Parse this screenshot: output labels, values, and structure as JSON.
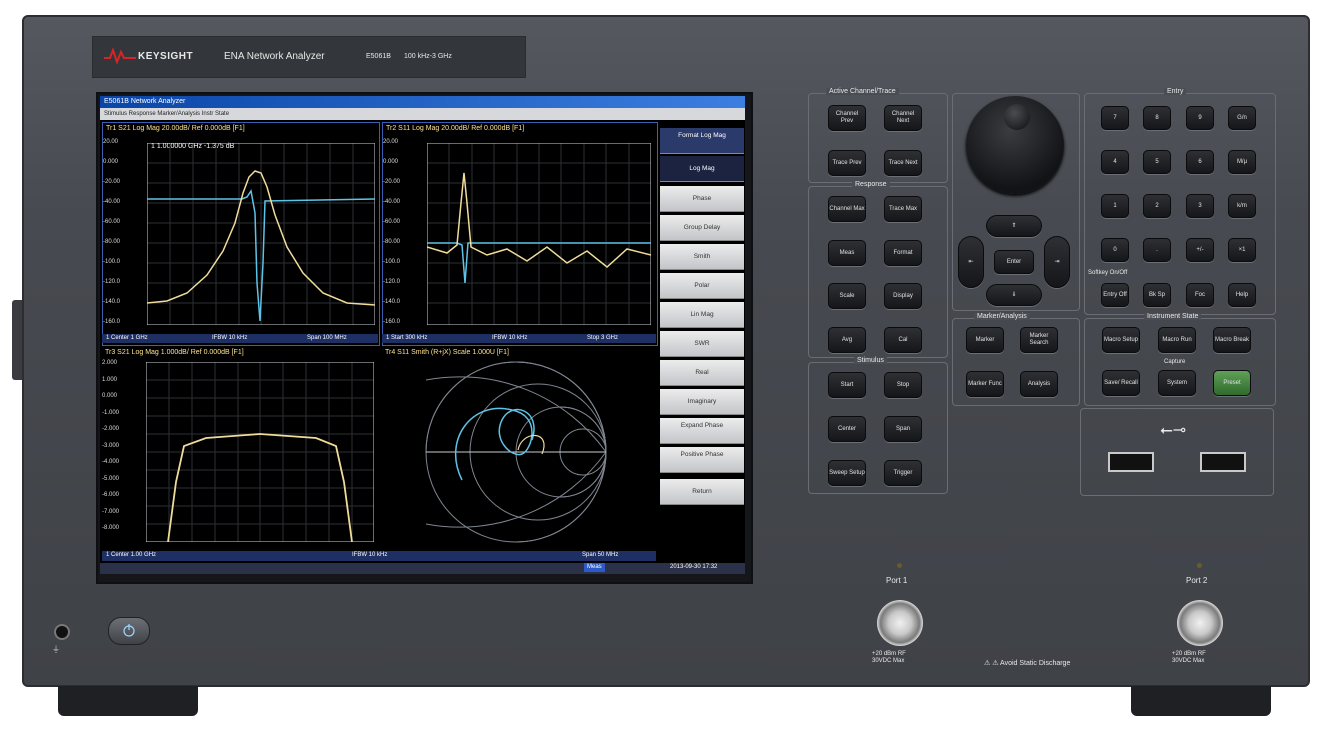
{
  "brand": {
    "logo_text": "KEYSIGHT",
    "product": "ENA Network Analyzer",
    "model": "E5061B",
    "range": "100 kHz-3 GHz",
    "accent": "#d42626"
  },
  "screen": {
    "window_title": "E5061B Network Analyzer",
    "menu": "Stimulus  Response  Marker/Analysis  Instr State",
    "trace1_title": "Tr1 S21 Log Mag 20.00dB/ Ref 0.000dB [F1]",
    "trace1_marker": "1 1.000000 GHz -1.375 dB",
    "trace2_title": "Tr2 S11 Log Mag 20.00dB/ Ref 0.000dB [F1]",
    "trace3_title": "Tr3 S21 Log Mag 1.000dB/ Ref 0.000dB [F1]",
    "trace4_title": "Tr4 S11 Smith (R+jX) Scale 1.000U [F1]",
    "y1_ticks": [
      "20.00",
      "0.000",
      "-20.00",
      "-40.00",
      "-60.00",
      "-80.00",
      "-100.0",
      "-120.0",
      "-140.0",
      "-160.0"
    ],
    "y2_ticks": [
      "20.00",
      "0.000",
      "-20.00",
      "-40.00",
      "-60.00",
      "-80.00",
      "-100.0",
      "-120.0",
      "-140.0",
      "-160.0"
    ],
    "y3_ticks": [
      "2.000",
      "1.000",
      "0.000",
      "-1.000",
      "-2.000",
      "-3.000",
      "-4.000",
      "-5.000",
      "-6.000",
      "-7.000",
      "-8.000"
    ],
    "status_top_left": "1 Center 1 GHz",
    "status_top_mid": "IFBW 10 kHz",
    "status_top_right": "Span 100 MHz",
    "status_top2_left": "1 Start 300 kHz",
    "status_top2_mid": "IFBW 10 kHz",
    "status_top2_right": "Stop 3 GHz",
    "status_bottom_left": "1 Center 1.00 GHz",
    "status_bottom_mid": "IFBW 10 kHz",
    "status_bottom_right": "Span 50 MHz",
    "footer_mode": "Meas",
    "footer_time": "2013-09-30 17:32",
    "softkeys": [
      "Format Log Mag",
      "Log Mag",
      "Phase",
      "Group Delay",
      "Smith",
      "Polar",
      "Lin Mag",
      "SWR",
      "Real",
      "Imaginary",
      "Expand Phase",
      "Positive Phase",
      "Return"
    ]
  },
  "panel": {
    "active": {
      "label": "Active Channel/Trace",
      "keys": [
        "Channel Prev",
        "Channel Next",
        "Trace Prev",
        "Trace Next"
      ]
    },
    "response": {
      "label": "Response",
      "keys": [
        "Channel Max",
        "Trace Max",
        "Meas",
        "Format",
        "Scale",
        "Display",
        "Avg",
        "Cal"
      ]
    },
    "stimulus": {
      "label": "Stimulus",
      "keys": [
        "Start",
        "Stop",
        "Center",
        "Span",
        "Sweep Setup",
        "Trigger"
      ]
    },
    "nav": {
      "enter": "Enter",
      "up": "⇑",
      "down": "⇓",
      "left": "⇤",
      "right": "⇥"
    },
    "marker": {
      "label": "Marker/Analysis",
      "keys": [
        "Marker",
        "Marker Search",
        "Marker Func",
        "Analysis"
      ]
    },
    "entry": {
      "label": "Entry",
      "keys": [
        "7",
        "8",
        "9",
        "G/n",
        "4",
        "5",
        "6",
        "M/μ",
        "1",
        "2",
        "3",
        "k/m",
        "0",
        ".",
        "+/-",
        "×1"
      ],
      "hint": "Softkey On/Off",
      "keys2": [
        "Entry Off",
        "Bk Sp",
        "Foc",
        "Help"
      ]
    },
    "instr": {
      "label": "Instrument State",
      "keys": [
        "Macro Setup",
        "Macro Run",
        "Macro Break"
      ],
      "capture": "Capture",
      "keys2": [
        "Save/ Recall",
        "System",
        "Preset"
      ]
    },
    "usb_symbol": "⭠⊸",
    "port1": "Port 1",
    "port2": "Port 2",
    "port_warning": "+20 dBm RF\n30VDC Max",
    "static_warning": "⚠ ⚠ Avoid Static Discharge"
  }
}
